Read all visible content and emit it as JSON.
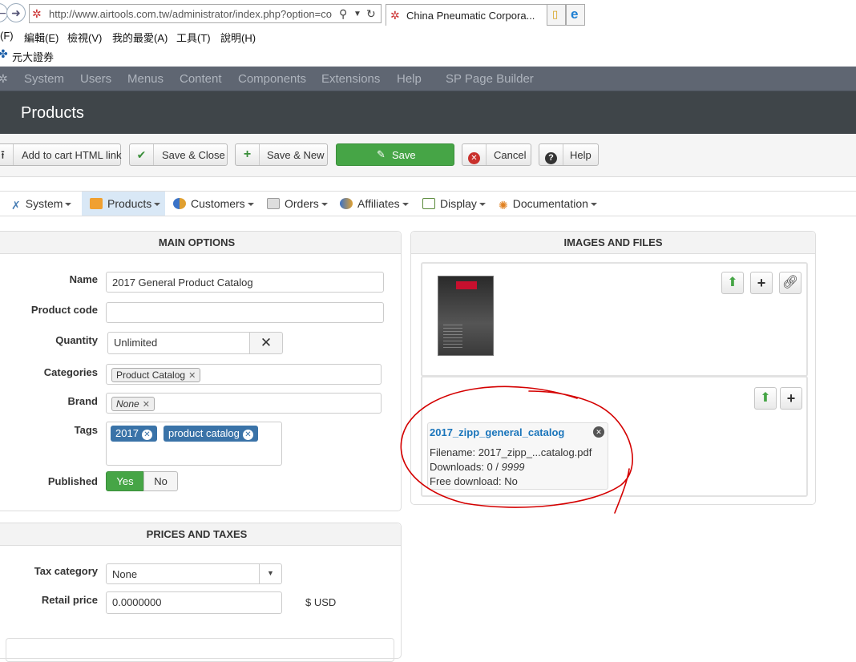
{
  "browser": {
    "url": "http://www.airtools.com.tw/administrator/index.php?option=co",
    "tab_title": "China Pneumatic Corpora...",
    "tab_close": "✕",
    "menu": [
      "(F)",
      "編輯(E)",
      "檢視(V)",
      "我的最愛(A)",
      "工具(T)",
      "說明(H)"
    ],
    "favorite": "元大證券"
  },
  "admin_nav": [
    "System",
    "Users",
    "Menus",
    "Content",
    "Components",
    "Extensions",
    "Help",
    "SP Page Builder"
  ],
  "page_title": "Products",
  "toolbar": {
    "add_cart": "Add to cart HTML link",
    "save_close": "Save & Close",
    "save_new": "Save & New",
    "save": "Save",
    "cancel": "Cancel",
    "help": "Help"
  },
  "component_menu": [
    "System",
    "Products",
    "Customers",
    "Orders",
    "Affiliates",
    "Display",
    "Documentation"
  ],
  "main_options": {
    "heading": "MAIN OPTIONS",
    "name_label": "Name",
    "name_value": "2017 General Product Catalog",
    "code_label": "Product code",
    "code_value": "",
    "quantity_label": "Quantity",
    "quantity_value": "Unlimited",
    "categories_label": "Categories",
    "category_chip": "Product Catalog",
    "brand_label": "Brand",
    "brand_chip": "None",
    "tags_label": "Tags",
    "tags": [
      "2017",
      "product catalog"
    ],
    "published_label": "Published",
    "yes": "Yes",
    "no": "No"
  },
  "prices": {
    "heading": "PRICES AND TAXES",
    "tax_label": "Tax category",
    "tax_value": "None",
    "retail_label": "Retail price",
    "retail_value": "0.0000000",
    "currency": "$ USD"
  },
  "images_files": {
    "heading": "IMAGES AND FILES",
    "file": {
      "title": "2017_zipp_general_catalog",
      "filename": "Filename: 2017_zipp_...catalog.pdf",
      "downloads_prefix": "Downloads: 0 / ",
      "downloads_max": "9999",
      "free": "Free download: No"
    }
  },
  "colors": {
    "admin_nav_bg": "#5f6672",
    "title_bar_bg": "#3f4549",
    "save_green": "#46a546",
    "tag_blue": "#3a73a8",
    "annotation_red": "#d40000"
  }
}
